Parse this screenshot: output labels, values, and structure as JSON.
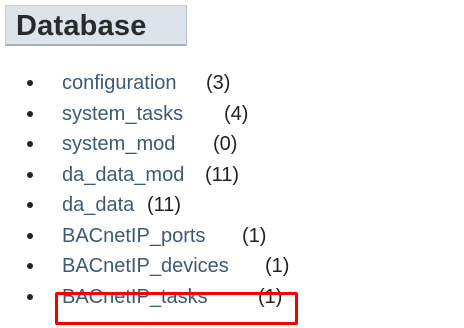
{
  "section": {
    "title": "Database"
  },
  "tables": [
    {
      "name": "configuration",
      "count": "(3)"
    },
    {
      "name": "system_tasks",
      "count": "(4)"
    },
    {
      "name": "system_mod",
      "count": "(0)"
    },
    {
      "name": "da_data_mod",
      "count": "(11)"
    },
    {
      "name": "da_data",
      "count": "(11)"
    },
    {
      "name": "BACnetIP_ports",
      "count": "(1)"
    },
    {
      "name": "BACnetIP_devices",
      "count": "(1)"
    },
    {
      "name": "BACnetIP_tasks",
      "count": "(1)"
    }
  ],
  "highlight": {
    "color": "#f40000",
    "target": "BACnetIP_tasks"
  },
  "colors": {
    "link": "#3c5a78",
    "header_bg": "#dde3ea",
    "text": "#222222"
  }
}
